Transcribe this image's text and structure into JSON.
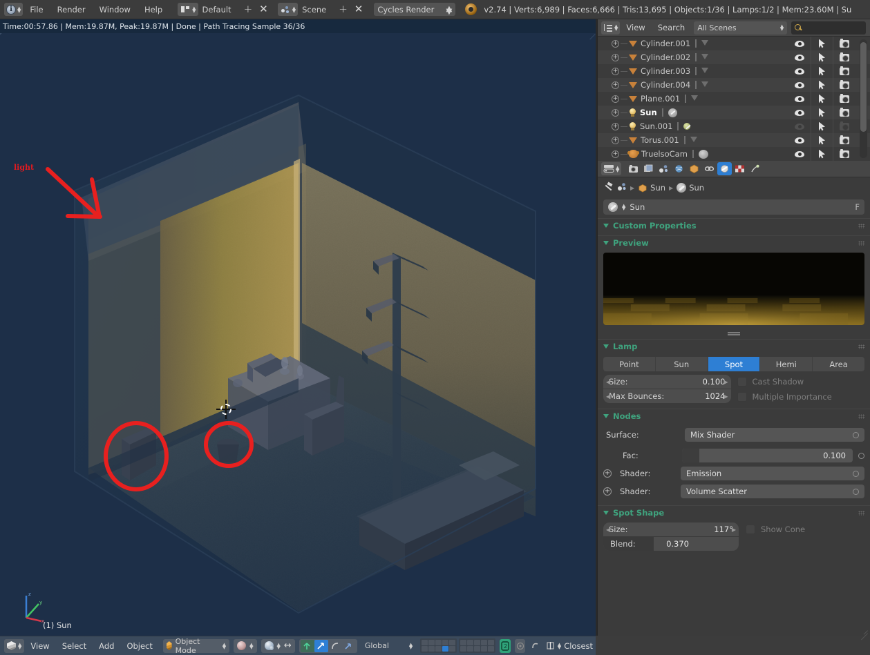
{
  "topbar": {
    "info_icon": "blender-info-icon",
    "menus": [
      "File",
      "Render",
      "Window",
      "Help"
    ],
    "screen_layout": "Default",
    "scene_name": "Scene",
    "render_engine": "Cycles Render",
    "stats": "v2.74 | Verts:6,989 | Faces:6,666 | Tris:13,695 | Objects:1/36 | Lamps:1/2 | Mem:23.60M | Su",
    "add_glyph": "+",
    "close_glyph": "✕"
  },
  "render_info": "Time:00:57.86 | Mem:19.87M, Peak:19.87M | Done | Path Tracing Sample 36/36",
  "viewport": {
    "status_text": "(1) Sun",
    "axis_labels": {
      "x": "x",
      "y": "y",
      "z": "z"
    },
    "annotations": {
      "light_label": "light",
      "arrow_color": "#e8201f",
      "circle_color": "#e8201f"
    },
    "background_color": "#1d2f48"
  },
  "viewport_footer": {
    "menus": [
      "View",
      "Select",
      "Add",
      "Object"
    ],
    "mode": "Object Mode",
    "transform_orientation": "Global",
    "snap_mode": "Closest",
    "editor_icon": "object-mode-cube-icon"
  },
  "outliner": {
    "view_label": "View",
    "search_label": "Search",
    "scene_filter": "All Scenes",
    "search_placeholder": "",
    "search_value": "",
    "rows": [
      {
        "name": "Cylinder.001",
        "type": "mesh",
        "selected": false,
        "data_icon": "mesh-data-icon",
        "visible": true,
        "selectable": true,
        "renderable": true
      },
      {
        "name": "Cylinder.002",
        "type": "mesh",
        "selected": false,
        "data_icon": "mesh-data-icon",
        "visible": true,
        "selectable": true,
        "renderable": true
      },
      {
        "name": "Cylinder.003",
        "type": "mesh",
        "selected": false,
        "data_icon": "mesh-data-icon",
        "visible": true,
        "selectable": true,
        "renderable": true
      },
      {
        "name": "Cylinder.004",
        "type": "mesh",
        "selected": false,
        "data_icon": "mesh-data-icon",
        "visible": true,
        "selectable": true,
        "renderable": true
      },
      {
        "name": "Plane.001",
        "type": "mesh",
        "selected": false,
        "data_icon": "mesh-data-icon",
        "visible": true,
        "selectable": true,
        "renderable": true
      },
      {
        "name": "Sun",
        "type": "lamp",
        "selected": true,
        "data_icon": "lamp-data-icon",
        "visible": true,
        "selectable": true,
        "renderable": true
      },
      {
        "name": "Sun.001",
        "type": "lamp",
        "selected": false,
        "data_icon": "lamp-data-icon-green",
        "visible": false,
        "selectable": true,
        "renderable": false
      },
      {
        "name": "Torus.001",
        "type": "mesh",
        "selected": false,
        "data_icon": "mesh-data-icon",
        "visible": true,
        "selectable": true,
        "renderable": true
      },
      {
        "name": "TruelsoCam",
        "type": "camera",
        "selected": false,
        "data_icon": "camera-data-icon",
        "visible": true,
        "selectable": true,
        "renderable": true
      }
    ]
  },
  "properties": {
    "tabs": [
      "render-icon",
      "render-layers-icon",
      "scene-icon",
      "world-icon",
      "object-icon",
      "constraints-icon",
      "lamp-data-icon",
      "texture-icon",
      "particles-icon"
    ],
    "active_tab_index": 6,
    "breadcrumb": {
      "object": "Sun",
      "data": "Sun"
    },
    "id_name": "Sun",
    "id_fake_user": "F",
    "panels": {
      "custom_properties": "Custom Properties",
      "preview": "Preview",
      "lamp": "Lamp",
      "nodes": "Nodes",
      "spot_shape": "Spot Shape"
    },
    "lamp": {
      "types": [
        "Point",
        "Sun",
        "Spot",
        "Hemi",
        "Area"
      ],
      "active_type": "Spot",
      "size_label": "Size:",
      "size_value": "0.100",
      "max_bounces_label": "Max Bounces:",
      "max_bounces_value": "1024",
      "cast_shadow_label": "Cast Shadow",
      "cast_shadow_checked": false,
      "multiple_importance_label": "Multiple Importance",
      "multiple_importance_checked": false
    },
    "nodes": {
      "surface_label": "Surface:",
      "surface_value": "Mix Shader",
      "fac_label": "Fac:",
      "fac_value": "0.100",
      "fac_fraction": 0.1,
      "shader1_label": "Shader:",
      "shader1_value": "Emission",
      "shader2_label": "Shader:",
      "shader2_value": "Volume Scatter"
    },
    "spot_shape": {
      "size_label": "Size:",
      "size_value": "117°",
      "blend_label": "Blend:",
      "blend_value": "0.370",
      "blend_fraction": 0.37,
      "show_cone_label": "Show Cone",
      "show_cone_checked": false
    }
  }
}
